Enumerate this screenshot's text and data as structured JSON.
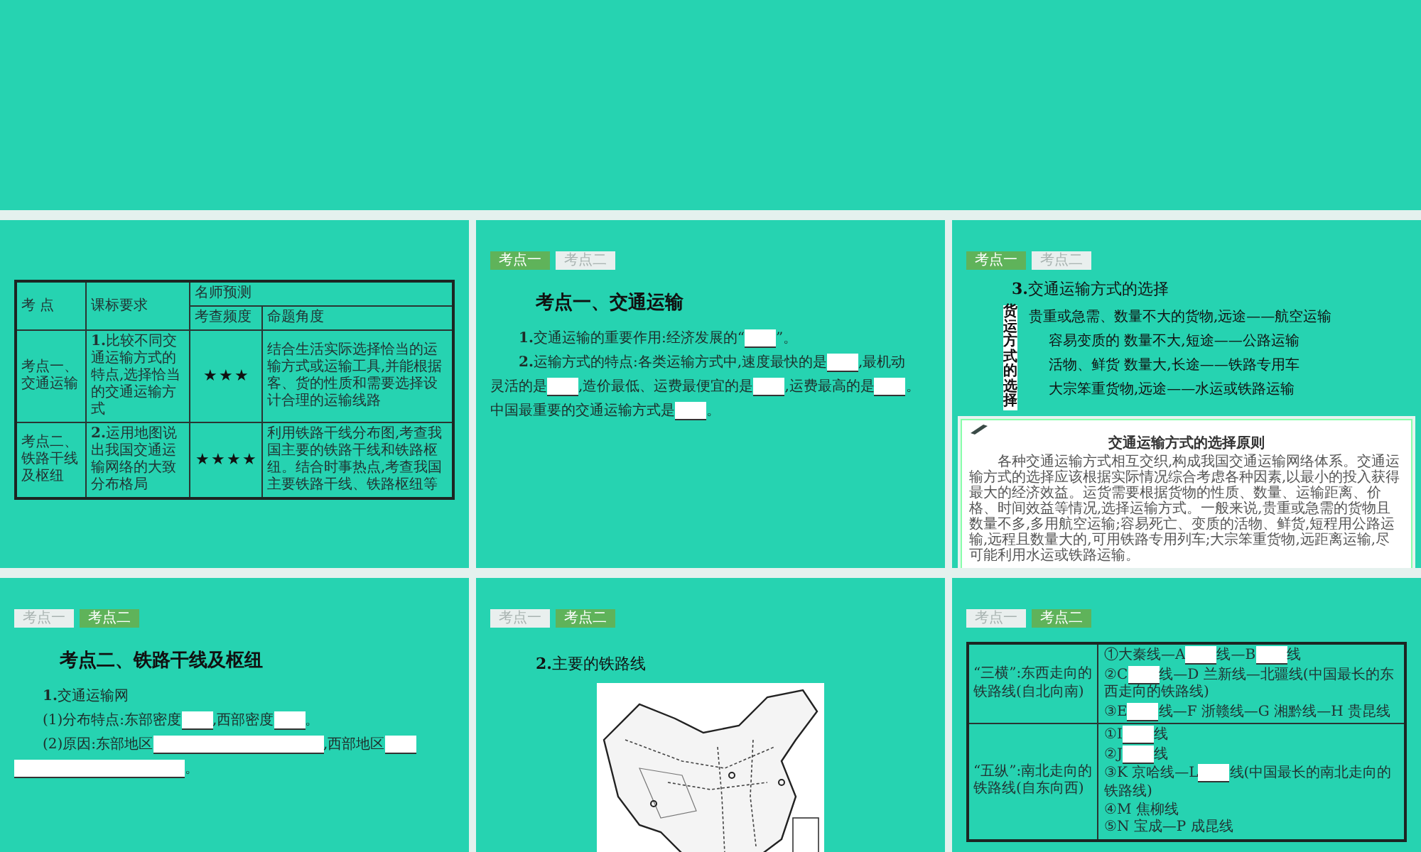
{
  "slides": [
    {
      "kind": "overview_table",
      "table": {
        "header": {
          "point": "考 点",
          "requirement": "课标要求",
          "group": "名师预测",
          "frequency": "考查频度",
          "angle": "命题角度"
        },
        "rows": [
          {
            "point": "考点一、交通运输",
            "requirement": "**1.**比较不同交通运输方式的特点,选择恰当的交通运输方式",
            "stars": 3,
            "angle": "结合生活实际选择恰当的运输方式或运输工具,并能根据客、货的性质和需要选择设计合理的运输线路"
          },
          {
            "point": "考点二、铁路干线及枢纽",
            "requirement": "**2.**运用地图说出我国交通运输网络的大致分布格局",
            "stars": 4,
            "angle": "利用铁路干线分布图,考查我国主要的铁路干线和铁路枢纽。结合时事热点,考查我国主要铁路干线、铁路枢纽等"
          }
        ]
      }
    },
    {
      "kind": "text",
      "tabs": [
        {
          "label": "考点一",
          "selected": true
        },
        {
          "label": "考点二",
          "selected": false
        }
      ],
      "heading": "考点一、交通运输",
      "paragraphs": [
        [
          [
            {
              "kind": "text",
              "text": "**1.**交通运输的重要作用:经济发展的“"
            },
            {
              "kind": "blank"
            },
            {
              "kind": "text",
              "text": "”。"
            }
          ]
        ],
        [
          [
            {
              "kind": "text",
              "text": "**2.**运输方式的特点:各类运输方式中,速度最快的是"
            },
            {
              "kind": "blank"
            },
            {
              "kind": "text",
              "text": ",最机动"
            }
          ],
          [
            {
              "kind": "text",
              "text": "灵活的是"
            },
            {
              "kind": "blank"
            },
            {
              "kind": "text",
              "text": ",造价最低、运费最便宜的是"
            },
            {
              "kind": "blank"
            },
            {
              "kind": "text",
              "text": ",运费最高的是"
            },
            {
              "kind": "blank"
            },
            {
              "kind": "text",
              "text": "。"
            }
          ],
          [
            {
              "kind": "text",
              "text": "中国最重要的交通运输方式是"
            },
            {
              "kind": "blank"
            },
            {
              "kind": "text",
              "text": "。"
            }
          ]
        ]
      ]
    },
    {
      "kind": "selection",
      "tabs": [
        {
          "label": "考点一",
          "selected": true
        },
        {
          "label": "考点二",
          "selected": false
        }
      ],
      "heading": "**3.**交通运输方式的选择",
      "side_label": "货运方式的选择",
      "lines": [
        "贵重或急需、数量不大的货物,远途——航空运输",
        "容易变质的 数量不大,短途——公路运输",
        "活物、鲜货 数量大,长途——铁路专用车",
        "大宗笨重货物,远途——水运或铁路运输"
      ],
      "note": {
        "title": "交通运输方式的选择原则",
        "body": "各种交通运输方式相互交织,构成我国交通运输网络体系。交通运输方式的选择应该根据实际情况综合考虑各种因素,以最小的投入获得最大的经济效益。运货需要根据货物的性质、数量、运输距离、价格、时间效益等情况,选择运输方式。一般来说,贵重或急需的货物且数量不多,多用航空运输;容易死亡、变质的活物、鲜货,短程用公路运输,远程且数量大的,可用铁路专用列车;大宗笨重货物,远距离运输,尽可能利用水运或铁路运输。"
      }
    },
    {
      "kind": "text",
      "tabs": [
        {
          "label": "考点一",
          "selected": false
        },
        {
          "label": "考点二",
          "selected": true
        }
      ],
      "heading": "考点二、铁路干线及枢纽",
      "paragraphs": [
        [
          [
            {
              "kind": "text",
              "text": "**1.**交通运输网"
            }
          ]
        ],
        [
          [
            {
              "kind": "text",
              "text": "(1)分布特点:东部密度"
            },
            {
              "kind": "blank"
            },
            {
              "kind": "text",
              "text": ",西部密度"
            },
            {
              "kind": "blank"
            },
            {
              "kind": "text",
              "text": "。"
            }
          ]
        ],
        [
          [
            {
              "kind": "text",
              "text": "(2)原因:东部地区"
            },
            {
              "kind": "wide_blank"
            },
            {
              "kind": "text",
              "text": ",西部地区"
            },
            {
              "kind": "blank"
            }
          ],
          [
            {
              "kind": "wide_blank"
            },
            {
              "kind": "text",
              "text": "。"
            }
          ]
        ]
      ]
    },
    {
      "kind": "map",
      "tabs": [
        {
          "label": "考点一",
          "selected": false
        },
        {
          "label": "考点二",
          "selected": true
        }
      ],
      "heading": "**2.**主要的铁路线"
    },
    {
      "kind": "rail_table",
      "tabs": [
        {
          "label": "考点一",
          "selected": false
        },
        {
          "label": "考点二",
          "selected": true
        }
      ],
      "rows": [
        {
          "group": "“三横”:东西走向的铁路线(自北向南)",
          "lines": [
            [
              {
                "kind": "text",
                "text": "①大秦线—A"
              },
              {
                "kind": "blank"
              },
              {
                "kind": "text",
                "text": "线—B"
              },
              {
                "kind": "blank"
              },
              {
                "kind": "text",
                "text": "线"
              }
            ],
            [
              {
                "kind": "text",
                "text": "②C"
              },
              {
                "kind": "blank"
              },
              {
                "kind": "text",
                "text": "线—D 兰新线—北疆线(中国最长的东"
              }
            ],
            [
              {
                "kind": "text",
                "text": "西走向的铁路线)"
              }
            ],
            [
              {
                "kind": "text",
                "text": "③E"
              },
              {
                "kind": "blank"
              },
              {
                "kind": "text",
                "text": "线—F 浙赣线—G 湘黔线—H 贵昆线"
              }
            ]
          ]
        },
        {
          "group": "“五纵”:南北走向的铁路线(自东向西)",
          "lines": [
            [
              {
                "kind": "text",
                "text": "①I"
              },
              {
                "kind": "blank"
              },
              {
                "kind": "text",
                "text": "线"
              }
            ],
            [
              {
                "kind": "text",
                "text": "②J"
              },
              {
                "kind": "blank"
              },
              {
                "kind": "text",
                "text": "线"
              }
            ],
            [
              {
                "kind": "text",
                "text": "③K 京哈线—L"
              },
              {
                "kind": "blank"
              },
              {
                "kind": "text",
                "text": "线(中国最长的南北走向的"
              }
            ],
            [
              {
                "kind": "text",
                "text": "铁路线)"
              }
            ],
            [
              {
                "kind": "text",
                "text": "④M 焦柳线"
              }
            ],
            [
              {
                "kind": "text",
                "text": "⑤N 宝成—P 成昆线"
              }
            ]
          ]
        }
      ]
    }
  ]
}
